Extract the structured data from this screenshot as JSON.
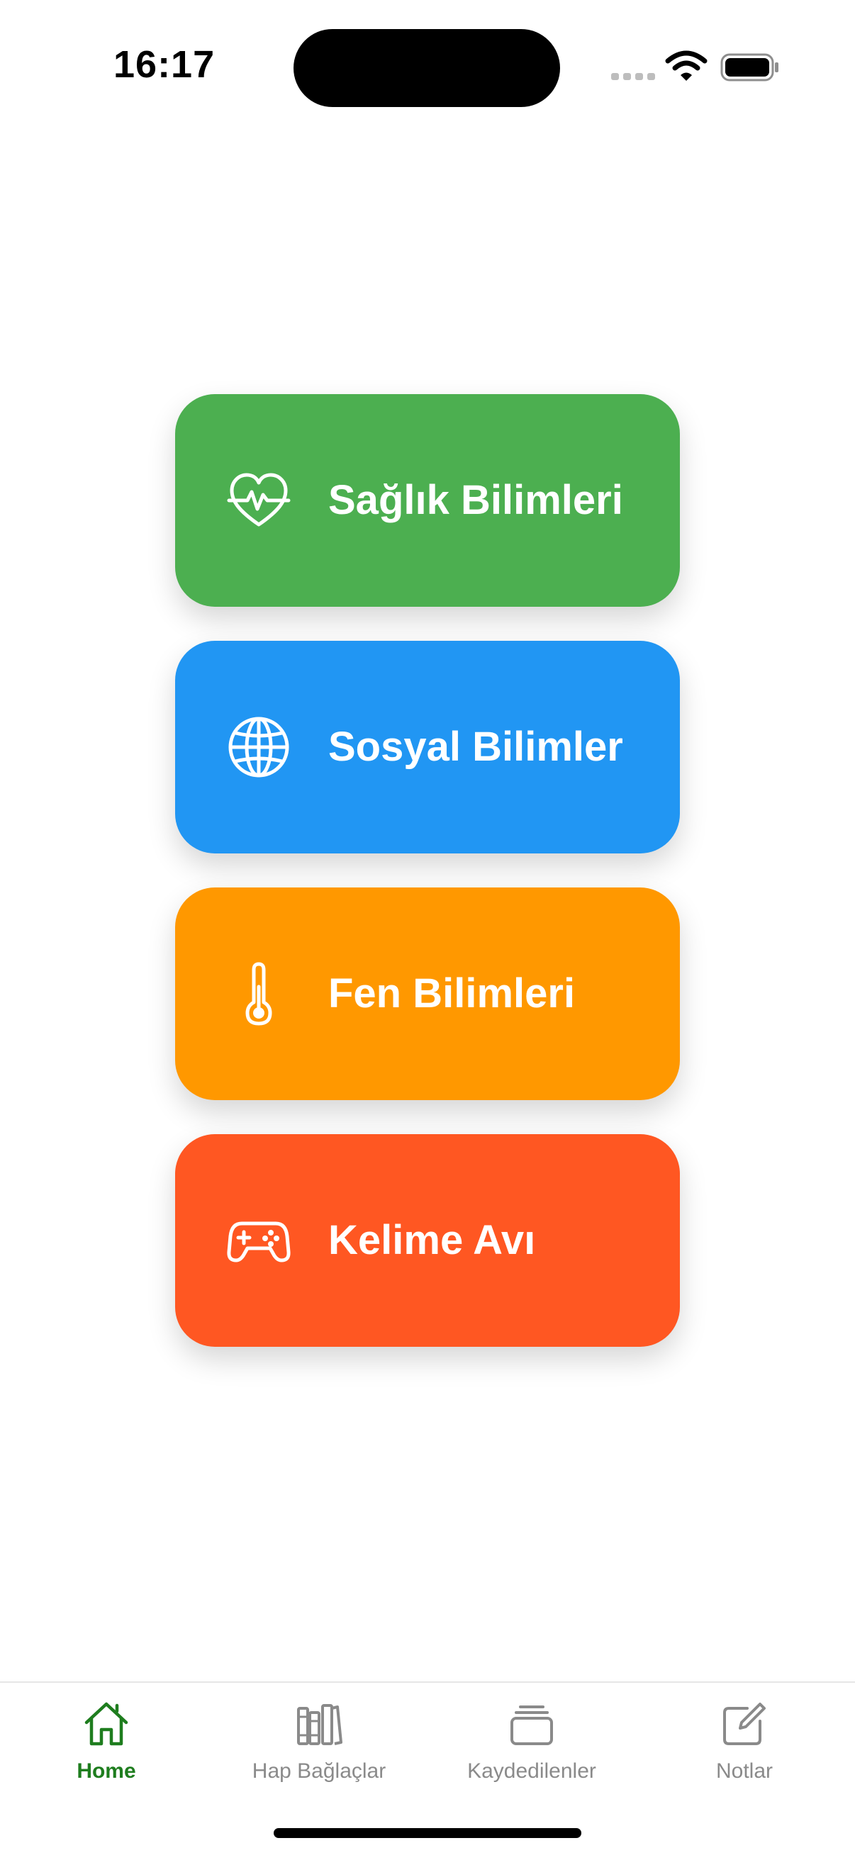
{
  "status_bar": {
    "time": "16:17"
  },
  "menu": {
    "items": [
      {
        "label": "Sağlık Bilimleri",
        "color": "#4CAF50",
        "icon": "heart-pulse-icon"
      },
      {
        "label": "Sosyal Bilimler",
        "color": "#2196F3",
        "icon": "globe-icon"
      },
      {
        "label": "Fen Bilimleri",
        "color": "#FF9800",
        "icon": "thermometer-icon"
      },
      {
        "label": "Kelime Avı",
        "color": "#FF5722",
        "icon": "gamepad-icon"
      }
    ]
  },
  "tab_bar": {
    "active_color": "#1E7D1E",
    "inactive_color": "#8A8A8A",
    "tabs": [
      {
        "label": "Home",
        "icon": "home-icon",
        "active": true
      },
      {
        "label": "Hap Bağlaçlar",
        "icon": "books-icon",
        "active": false
      },
      {
        "label": "Kaydedilenler",
        "icon": "stack-icon",
        "active": false
      },
      {
        "label": "Notlar",
        "icon": "edit-note-icon",
        "active": false
      }
    ]
  }
}
